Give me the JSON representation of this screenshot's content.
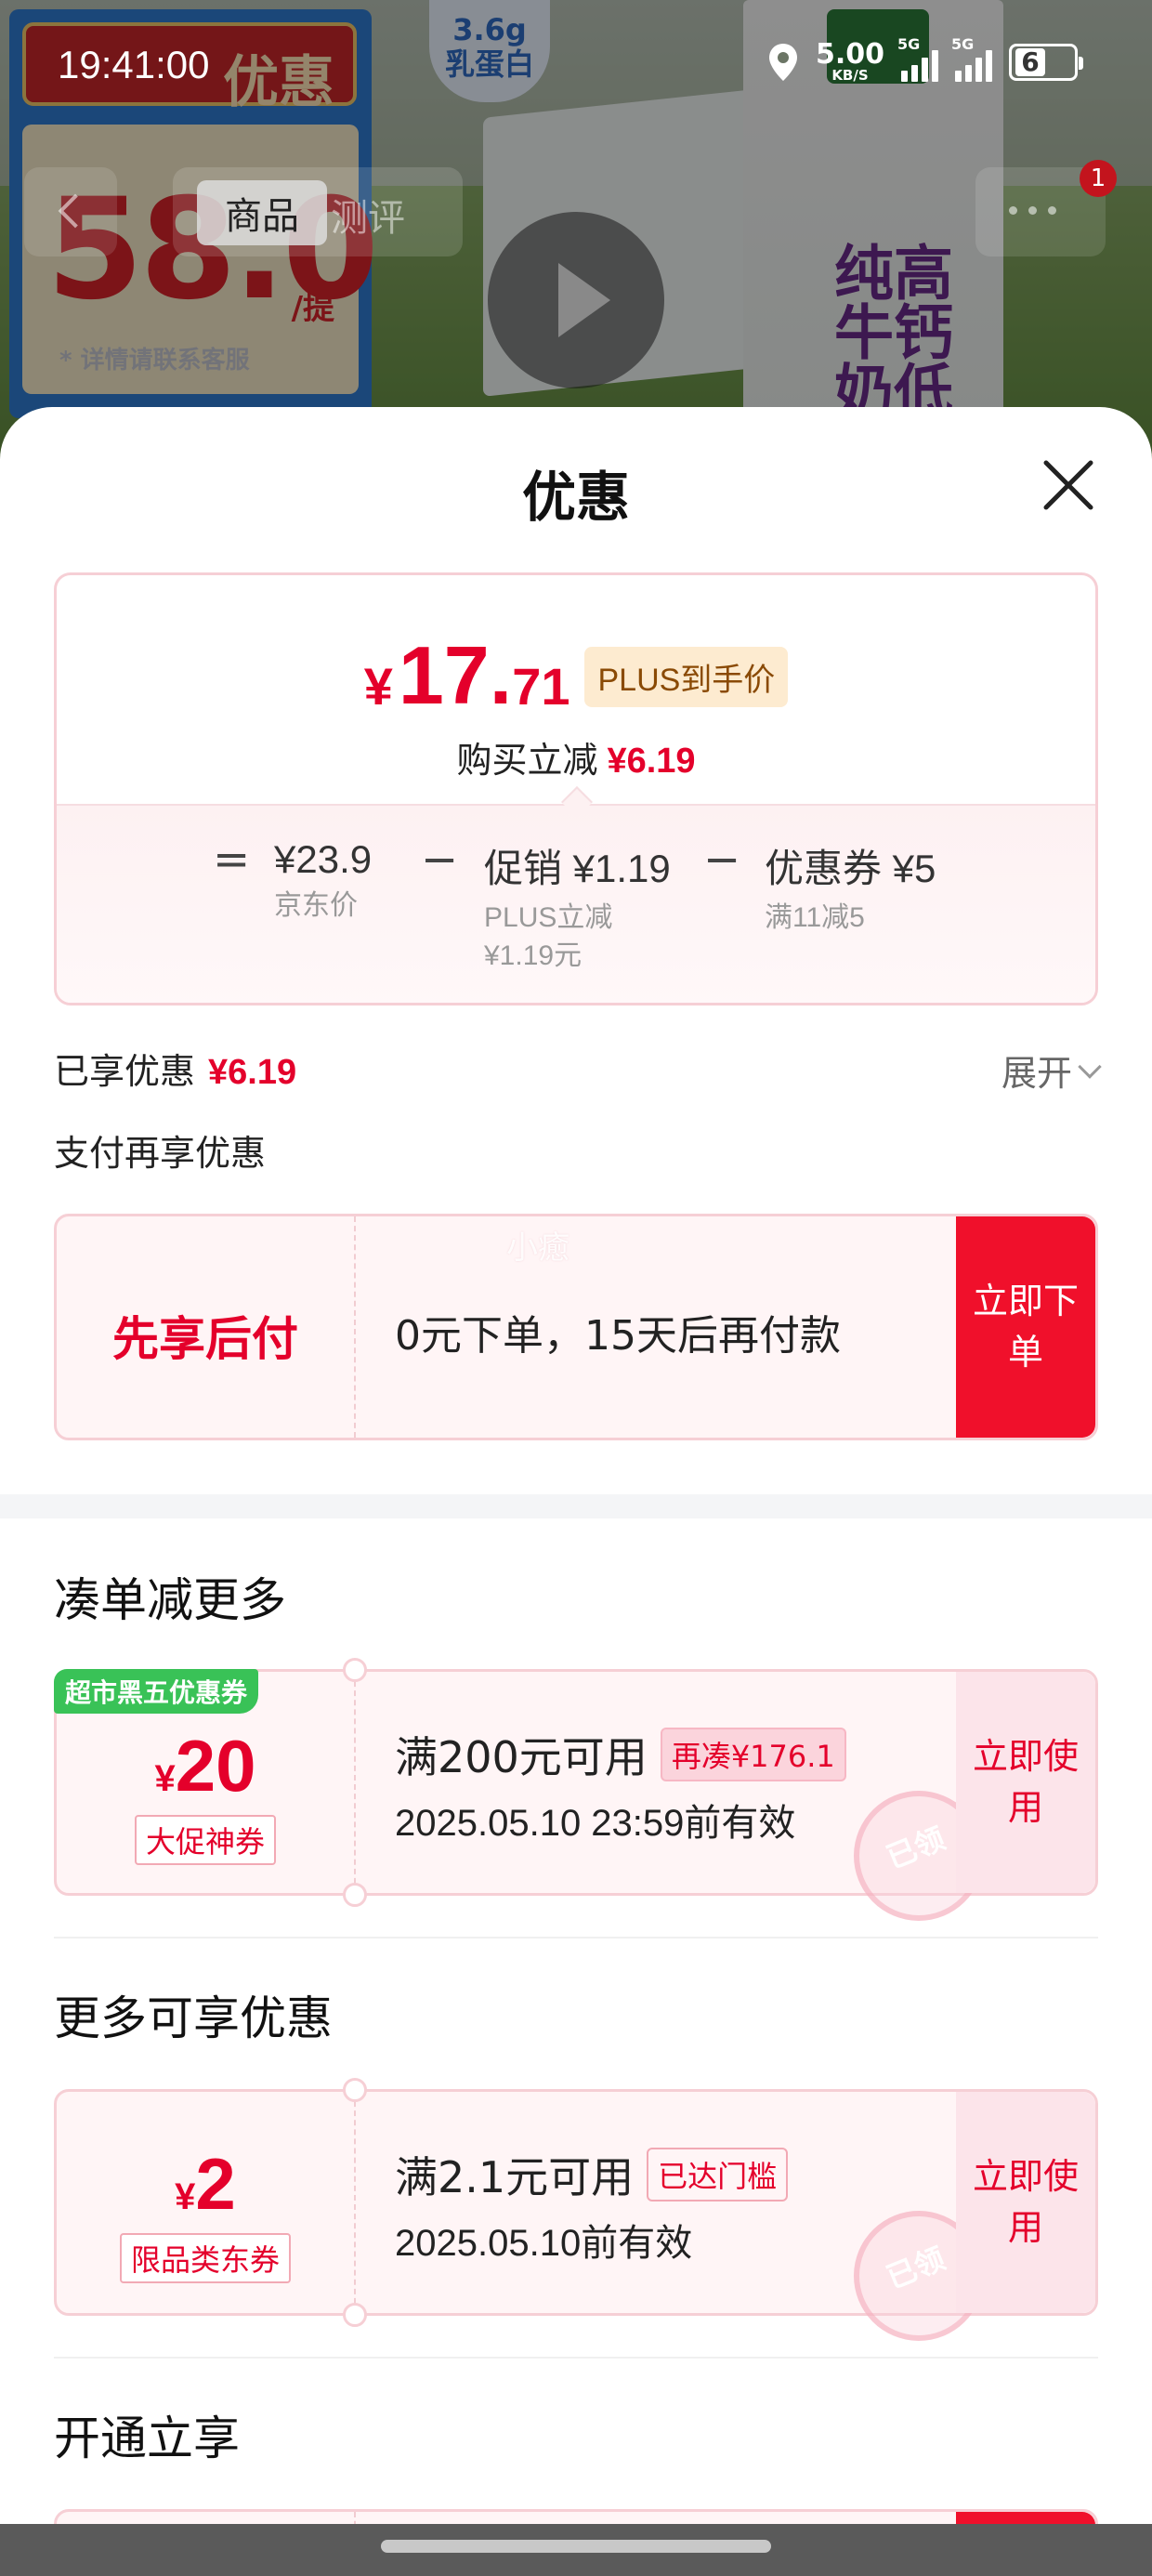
{
  "status_bar": {
    "time": "19:41:00",
    "net_speed": "5.00",
    "net_unit": "KB/S",
    "sim1": "5G",
    "sim2": "5G",
    "battery": "6"
  },
  "background_page": {
    "promo_banner": "优惠",
    "promo_price": "58.0",
    "promo_unit": "/提",
    "promo_note": "* 详情请联系客服",
    "product_badge": "3.6g\n乳蛋白",
    "product_text": "高钙低脂纯牛奶",
    "tabs": [
      "商品",
      "测评"
    ],
    "notification_count": "1"
  },
  "sheet": {
    "title": "优惠",
    "summary": {
      "currency": "¥",
      "price_int": "17.",
      "price_dec": "71",
      "plus_tag": "PLUS到手价",
      "save_label": "购买立减",
      "save_amount": "¥6.19",
      "eq": "=",
      "minus1": "−",
      "minus2": "−",
      "jd_price": "¥23.9",
      "jd_price_label": "京东价",
      "promo": "促销 ¥1.19",
      "promo_sub1": "PLUS立减",
      "promo_sub2": "¥1.19元",
      "coupon": "优惠券 ¥5",
      "coupon_sub": "满11减5"
    },
    "enjoyed_label": "已享优惠",
    "enjoyed_amount": "¥6.19",
    "expand_label": "展开",
    "pay_more_title": "支付再享优惠",
    "bnpl": {
      "title": "先享后付",
      "desc": "0元下单，15天后再付款",
      "watermark": "小癒",
      "action": "立即下单"
    },
    "section_add_more": "凑单减更多",
    "coupon1": {
      "ribbon": "超市黑五优惠券",
      "currency": "¥",
      "amount": "20",
      "type": "大促神券",
      "condition": "满200元可用",
      "tag": "再凑¥176.1",
      "validity": "2025.05.10 23:59前有效",
      "stamp": "已领",
      "action": "立即使用"
    },
    "section_more": "更多可享优惠",
    "coupon2": {
      "currency": "¥",
      "amount": "2",
      "type": "限品类东券",
      "condition": "满2.1元可用",
      "tag": "已达门槛",
      "validity": "2025.05.10前有效",
      "stamp": "已领",
      "action": "立即使用"
    },
    "section_open": "开通立享"
  },
  "colors": {
    "accent_red": "#e4002b",
    "button_red": "#f0102b",
    "ribbon_green": "#39c257",
    "plus_gold_bg": "#fdebd0"
  }
}
